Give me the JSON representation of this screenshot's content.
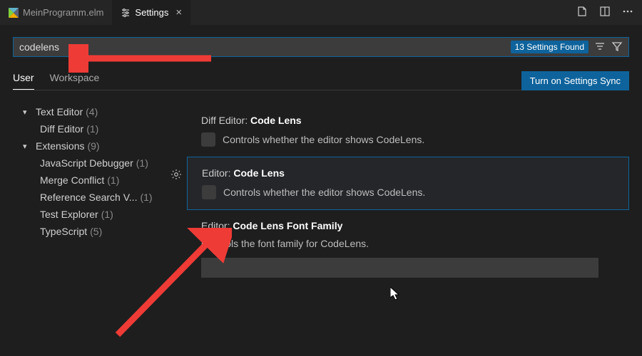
{
  "tabs": {
    "file": "MeinProgramm.elm",
    "settings": "Settings"
  },
  "search": {
    "query": "codelens",
    "found": "13 Settings Found"
  },
  "scope": {
    "user": "User",
    "workspace": "Workspace"
  },
  "sync": "Turn on Settings Sync",
  "tree": {
    "textEditor": "Text Editor",
    "textEditorCount": "(4)",
    "diffEditor": "Diff Editor",
    "diffEditorCount": "(1)",
    "extensions": "Extensions",
    "extensionsCount": "(9)",
    "jsDebugger": "JavaScript Debugger",
    "jsDebuggerCount": "(1)",
    "mergeConflict": "Merge Conflict",
    "mergeConflictCount": "(1)",
    "refSearch": "Reference Search V...",
    "refSearchCount": "(1)",
    "testExplorer": "Test Explorer",
    "testExplorerCount": "(1)",
    "typescript": "TypeScript",
    "typescriptCount": "(5)"
  },
  "settings": {
    "diffPrefix": "Diff Editor: ",
    "diffTitle": "Code Lens",
    "diffDesc": "Controls whether the editor shows CodeLens.",
    "edPrefix": "Editor: ",
    "edTitle": "Code Lens",
    "edDesc": "Controls whether the editor shows CodeLens.",
    "ffPrefix": "Editor: ",
    "ffTitle": "Code Lens Font Family",
    "ffDesc": "Controls the font family for CodeLens."
  }
}
